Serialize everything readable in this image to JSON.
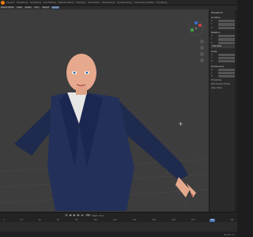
{
  "menu": {
    "items": [
      "Layout",
      "Modeling",
      "Sculpting",
      "UV Editing",
      "Texture Paint",
      "Shading",
      "Animation",
      "Rendering",
      "Compositing",
      "Geometry Nodes",
      "Scripting"
    ]
  },
  "toolbar": {
    "mode": "Object Mode",
    "view": "View",
    "select": "Select",
    "add": "Add",
    "object": "Object",
    "transform": "Global"
  },
  "sidebar": {
    "panel_title": "Transform",
    "location_label": "Location",
    "location": {
      "x": "",
      "y": "",
      "z": ""
    },
    "rotation_label": "Rotation",
    "rotation": {
      "x": "",
      "y": "",
      "z": ""
    },
    "mode_label": "XYZ Euler",
    "scale_label": "Scale",
    "scale": {
      "x": "",
      "y": "",
      "z": ""
    },
    "dimensions_label": "Dimensions",
    "dimensions": {
      "x": "",
      "y": "",
      "z": ""
    },
    "properties_label": "Properties",
    "custom_props_label": "Edit Custom Props",
    "align_tools_label": "Align Tools"
  },
  "timeline": {
    "frames": [
      "0",
      "20",
      "40",
      "60",
      "80",
      "100",
      "120",
      "140",
      "160",
      "180",
      "200",
      "220",
      "240"
    ],
    "current_frame": "250",
    "start_label": "Start",
    "end_label": "End"
  },
  "status": {
    "version": "Blender 3.x"
  }
}
